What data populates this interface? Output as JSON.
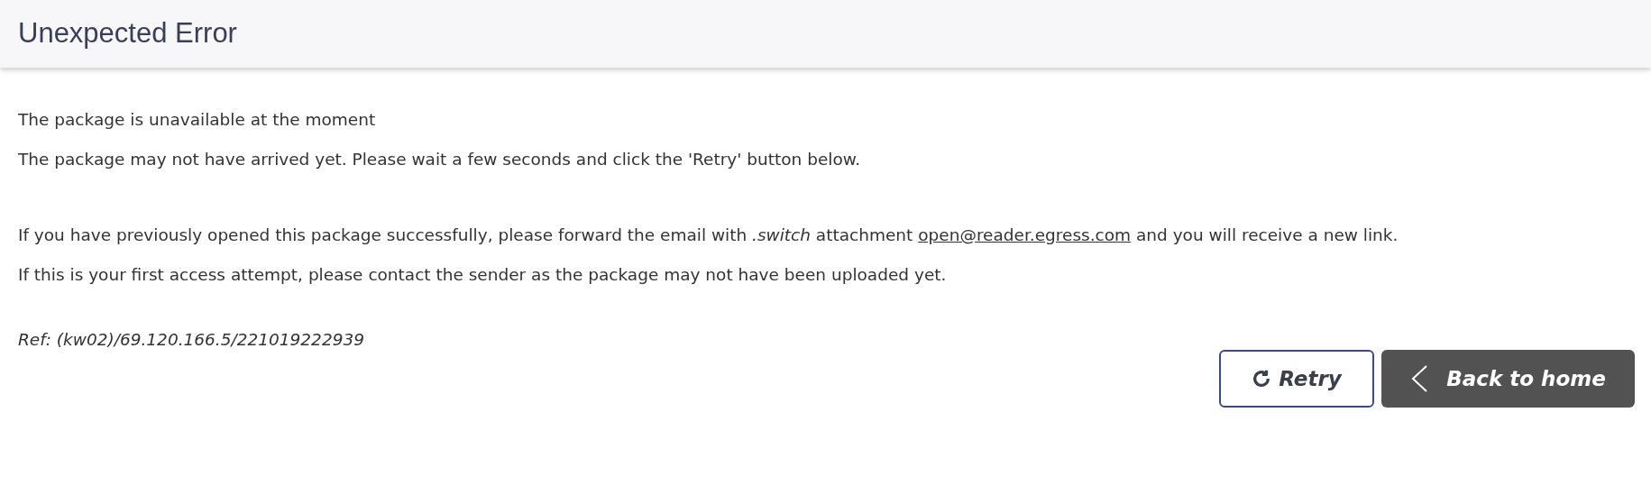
{
  "header": {
    "title": "Unexpected Error"
  },
  "messages": [
    {
      "kind": "text",
      "text": "The package is unavailable at the moment"
    },
    {
      "kind": "text",
      "text": "The package may not have arrived yet. Please wait a few seconds and click the 'Retry' button below."
    },
    {
      "kind": "spacer"
    },
    {
      "kind": "link",
      "before": "If you have previously opened this package successfully, please forward the email with *.switch* attachment",
      "link": "open@reader.egress.com",
      "after": "and you will receive a new link."
    },
    {
      "kind": "text",
      "text": "If this is your first access attempt, please contact the sender as the package may not have been uploaded yet."
    }
  ],
  "reference": "Ref: (kw02)/69.120.166.5/221019222939",
  "buttons": [
    {
      "kind": "retry",
      "label": "Retry"
    },
    {
      "kind": "back",
      "label": "Back to home"
    }
  ]
}
